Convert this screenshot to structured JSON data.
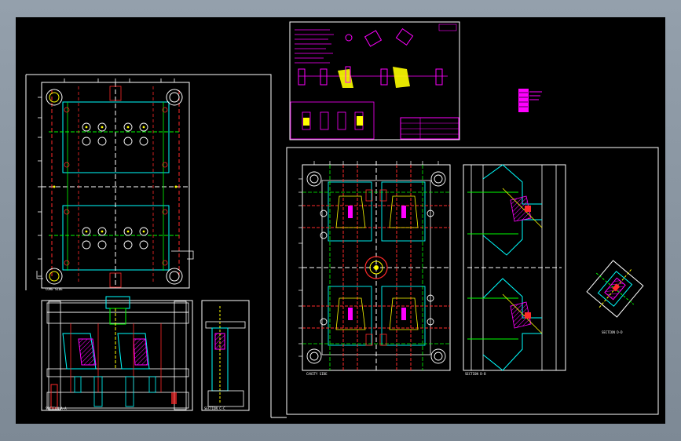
{
  "views": {
    "left_plan_label": "CORE SIDE",
    "left_section_label": "SECTION A-A",
    "left_small_section_label": "SECTION C-C",
    "right_plan_label": "CAVITY SIDE",
    "right_section_label": "SECTION B-B",
    "right_detail_label": "SECTION D-D"
  },
  "colors": {
    "background": "#000000",
    "frame": "#8e9aa6",
    "white": "#ffffff",
    "cyan": "#00ffff",
    "green": "#00ff00",
    "red": "#ff2a2a",
    "yellow": "#ffff00",
    "magenta": "#ff00ff"
  }
}
